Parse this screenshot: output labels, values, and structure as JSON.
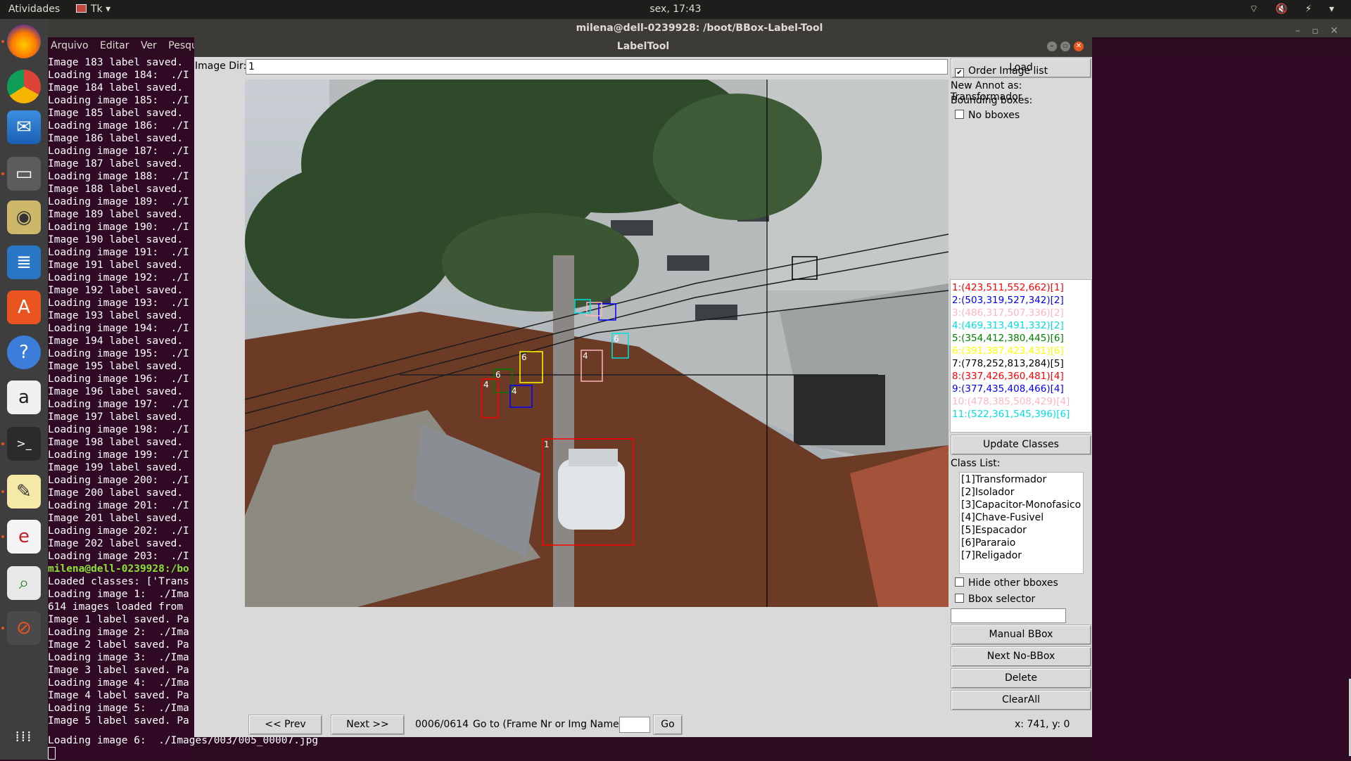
{
  "topbar": {
    "activities": "Atividades",
    "app_menu": "Tk ▾",
    "clock": "sex, 17:43",
    "tray": "⌔ 🔇 ⚡ ▾"
  },
  "terminal": {
    "title": "milena@dell-0239928: /boot/BBox-Label-Tool",
    "controls": "– ▫ ✕",
    "menu": [
      "Arquivo",
      "Editar",
      "Ver",
      "Pesqui"
    ],
    "lines": [
      "Image 183 label saved.",
      "Loading image 184:  ./I",
      "Image 184 label saved.",
      "Loading image 185:  ./I",
      "Image 185 label saved.",
      "Loading image 186:  ./I",
      "Image 186 label saved.",
      "Loading image 187:  ./I",
      "Image 187 label saved.",
      "Loading image 188:  ./I",
      "Image 188 label saved.",
      "Loading image 189:  ./I",
      "Image 189 label saved.",
      "Loading image 190:  ./I",
      "Image 190 label saved.",
      "Loading image 191:  ./I",
      "Image 191 label saved.",
      "Loading image 192:  ./I",
      "Image 192 label saved.",
      "Loading image 193:  ./I",
      "Image 193 label saved.",
      "Loading image 194:  ./I",
      "Image 194 label saved.",
      "Loading image 195:  ./I",
      "Image 195 label saved.",
      "Loading image 196:  ./I",
      "Image 196 label saved.",
      "Loading image 197:  ./I",
      "Image 197 label saved.",
      "Loading image 198:  ./I",
      "Image 198 label saved.",
      "Loading image 199:  ./I",
      "Image 199 label saved.",
      "Loading image 200:  ./I",
      "Image 200 label saved.",
      "Loading image 201:  ./I",
      "Image 201 label saved.",
      "Loading image 202:  ./I",
      "Image 202 label saved.",
      "Loading image 203:  ./I",
      "milena@dell-0239928:/bo",
      "Loaded classes: ['Trans",
      "Loading image 1:  ./Ima",
      "614 images loaded from",
      "Image 1 label saved. Pa",
      "Loading image 2:  ./Ima",
      "Image 2 label saved. Pa",
      "Loading image 3:  ./Ima",
      "Image 3 label saved. Pa",
      "Loading image 4:  ./Ima",
      "Image 4 label saved. Pa",
      "Loading image 5:  ./Ima",
      "Image 5 label saved. Pa"
    ],
    "last_line": "Loading image 6:  ./Images/003/005_00007.jpg"
  },
  "labeltool": {
    "title": "LabelTool",
    "image_dir_label": "Image Dir:",
    "image_dir_value": "1",
    "load_button": "Load",
    "order_image_list": "Order Image list",
    "new_annot": "New Annot as: Transformador",
    "bounding_boxes_label": "Bounding boxes:",
    "no_bboxes": "No bboxes",
    "bbox_list": [
      {
        "text": "1:(423,511,552,662)[1]",
        "color": "#ff0000"
      },
      {
        "text": "2:(503,319,527,342)[2]",
        "color": "#0000ff"
      },
      {
        "text": "3:(486,317,507,336)[2]",
        "color": "#ffb6c1"
      },
      {
        "text": "4:(469,313,491,332)[2]",
        "color": "#00e0e0"
      },
      {
        "text": "5:(354,412,380,445)[6]",
        "color": "#008000"
      },
      {
        "text": "6:(391,387,423,431)[6]",
        "color": "#ffff00"
      },
      {
        "text": "7:(778,252,813,284)[5]",
        "color": "#000000"
      },
      {
        "text": "8:(337,426,360,481)[4]",
        "color": "#ff0000"
      },
      {
        "text": "9:(377,435,408,466)[4]",
        "color": "#0000ff"
      },
      {
        "text": "10:(478,385,508,429)[4]",
        "color": "#ffb6c1"
      },
      {
        "text": "11:(522,361,545,396)[6]",
        "color": "#00e0e0"
      }
    ],
    "update_classes": "Update Classes",
    "class_list_label": "Class List:",
    "classes": [
      "[1]Transformador",
      "[2]Isolador",
      "[3]Capacitor-Monofasico",
      "[4]Chave-Fusivel",
      "[5]Espacador",
      "[6]Pararaio",
      "[7]Religador"
    ],
    "hide_other": "Hide other bboxes",
    "bbox_selector": "Bbox selector",
    "manual_bbox": "Manual BBox",
    "next_no_bbox": "Next No-BBox",
    "delete": "Delete",
    "clear_all": "ClearAll",
    "prev": "<< Prev",
    "next": "Next >>",
    "progress": "0006/0614",
    "goto_label": "Go to (Frame Nr or Img Name)",
    "go": "Go",
    "coords": "x: 741, y: 0"
  },
  "canvas_boxes": [
    {
      "label": "1",
      "color": "#ff0000"
    },
    {
      "label": "",
      "color": "#0000ff"
    },
    {
      "label": "",
      "color": "#ffb6c1"
    },
    {
      "label": "",
      "color": "#00e0e0"
    },
    {
      "label": "6",
      "color": "#008000"
    },
    {
      "label": "6",
      "color": "#ffff00"
    },
    {
      "label": "",
      "color": "#000000"
    },
    {
      "label": "4",
      "color": "#ff0000"
    },
    {
      "label": "4",
      "color": "#0000ff"
    },
    {
      "label": "4",
      "color": "#ffb6c1"
    },
    {
      "label": "6",
      "color": "#00e0e0"
    }
  ]
}
